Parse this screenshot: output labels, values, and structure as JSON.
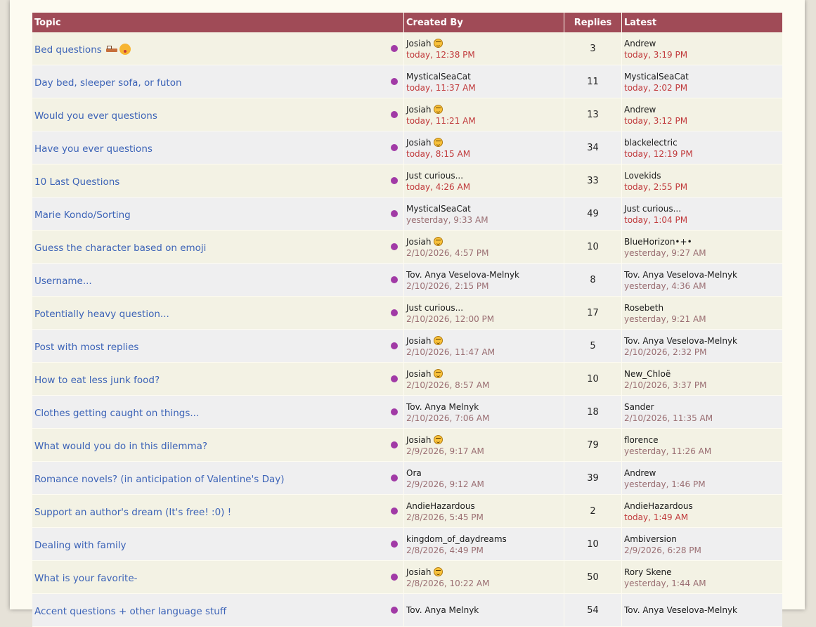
{
  "colors": {
    "header_bg": "#a04b57",
    "link": "#3c63b7",
    "dot": "#a13aa6",
    "recent_time": "#c0393b",
    "old_time": "#9a6e72"
  },
  "headers": {
    "topic": "Topic",
    "created_by": "Created By",
    "replies": "Replies",
    "latest": "Latest"
  },
  "topics": [
    {
      "title": "Bed questions",
      "title_icons": [
        "bed-icon",
        "kiss-face-icon"
      ],
      "creator": "Josiah",
      "creator_icon": "upside-down-face-icon",
      "created": "today, 12:38 PM",
      "created_recent": true,
      "replies": "3",
      "latest_user": "Andrew",
      "latest_time": "today, 3:19 PM",
      "latest_recent": true
    },
    {
      "title": "Day bed, sleeper sofa, or futon",
      "creator": "MysticalSeaCat",
      "created": "today, 11:37 AM",
      "created_recent": true,
      "replies": "11",
      "latest_user": "MysticalSeaCat",
      "latest_time": "today, 2:02 PM",
      "latest_recent": true
    },
    {
      "title": "Would you ever questions",
      "creator": "Josiah",
      "creator_icon": "upside-down-face-icon",
      "created": "today, 11:21 AM",
      "created_recent": true,
      "replies": "13",
      "latest_user": "Andrew",
      "latest_time": "today, 3:12 PM",
      "latest_recent": true
    },
    {
      "title": "Have you ever questions",
      "creator": "Josiah",
      "creator_icon": "upside-down-face-icon",
      "created": "today, 8:15 AM",
      "created_recent": true,
      "replies": "34",
      "latest_user": "blackelectric",
      "latest_time": "today, 12:19 PM",
      "latest_recent": true
    },
    {
      "title": "10 Last Questions",
      "creator": "Just curious...",
      "created": "today, 4:26 AM",
      "created_recent": true,
      "replies": "33",
      "latest_user": "Lovekids",
      "latest_time": "today, 2:55 PM",
      "latest_recent": true
    },
    {
      "title": "Marie Kondo/Sorting",
      "creator": "MysticalSeaCat",
      "created": "yesterday, 9:33 AM",
      "created_recent": false,
      "replies": "49",
      "latest_user": "Just curious...",
      "latest_time": "today, 1:04 PM",
      "latest_recent": true
    },
    {
      "title": "Guess the character based on emoji",
      "creator": "Josiah",
      "creator_icon": "upside-down-face-icon",
      "created": "2/10/2026, 4:57 PM",
      "created_recent": false,
      "replies": "10",
      "latest_user": "BlueHorizon•+•",
      "latest_time": "yesterday, 9:27 AM",
      "latest_recent": false
    },
    {
      "title": "Username...",
      "creator": "Tov. Anya Veselova-Melnyk",
      "created": "2/10/2026, 2:15 PM",
      "created_recent": false,
      "replies": "8",
      "latest_user": "Tov. Anya Veselova-Melnyk",
      "latest_time": "yesterday, 4:36 AM",
      "latest_recent": false
    },
    {
      "title": "Potentially heavy question...",
      "creator": "Just curious...",
      "created": "2/10/2026, 12:00 PM",
      "created_recent": false,
      "replies": "17",
      "latest_user": "Rosebeth",
      "latest_time": "yesterday, 9:21 AM",
      "latest_recent": false
    },
    {
      "title": "Post with most replies",
      "creator": "Josiah",
      "creator_icon": "upside-down-face-icon",
      "created": "2/10/2026, 11:47 AM",
      "created_recent": false,
      "replies": "5",
      "latest_user": "Tov. Anya Veselova-Melnyk",
      "latest_time": "2/10/2026, 2:32 PM",
      "latest_recent": false
    },
    {
      "title": "How to eat less junk food?",
      "creator": "Josiah",
      "creator_icon": "upside-down-face-icon",
      "created": "2/10/2026, 8:57 AM",
      "created_recent": false,
      "replies": "10",
      "latest_user": "New_Chloë",
      "latest_time": "2/10/2026, 3:37 PM",
      "latest_recent": false
    },
    {
      "title": "Clothes getting caught on things...",
      "creator": "Tov. Anya Melnyk",
      "created": "2/10/2026, 7:06 AM",
      "created_recent": false,
      "replies": "18",
      "latest_user": "Sander",
      "latest_time": "2/10/2026, 11:35 AM",
      "latest_recent": false
    },
    {
      "title": "What would you do in this dilemma?",
      "creator": "Josiah",
      "creator_icon": "upside-down-face-icon",
      "created": "2/9/2026, 9:17 AM",
      "created_recent": false,
      "replies": "79",
      "latest_user": "florence",
      "latest_time": "yesterday, 11:26 AM",
      "latest_recent": false
    },
    {
      "title": "Romance novels? (in anticipation of Valentine's Day)",
      "creator": "Ora",
      "created": "2/9/2026, 9:12 AM",
      "created_recent": false,
      "replies": "39",
      "latest_user": "Andrew",
      "latest_time": "yesterday, 1:46 PM",
      "latest_recent": false
    },
    {
      "title": "Support an author's dream (It's free! :0) !",
      "creator": "AndieHazardous",
      "created": "2/8/2026, 5:45 PM",
      "created_recent": false,
      "replies": "2",
      "latest_user": "AndieHazardous",
      "latest_time": "today, 1:49 AM",
      "latest_recent": true
    },
    {
      "title": "Dealing with family",
      "creator": "kingdom_of_daydreams",
      "created": "2/8/2026, 4:49 PM",
      "created_recent": false,
      "replies": "10",
      "latest_user": "Ambiversion",
      "latest_time": "2/9/2026, 6:28 PM",
      "latest_recent": false
    },
    {
      "title": "What is your favorite-",
      "creator": "Josiah",
      "creator_icon": "upside-down-face-icon",
      "created": "2/8/2026, 10:22 AM",
      "created_recent": false,
      "replies": "50",
      "latest_user": "Rory Skene",
      "latest_time": "yesterday, 1:44 AM",
      "latest_recent": false
    },
    {
      "title": "Accent questions + other language stuff",
      "creator": "Tov. Anya Melnyk",
      "created": "",
      "created_recent": false,
      "replies": "54",
      "latest_user": "Tov. Anya Veselova-Melnyk",
      "latest_time": "",
      "latest_recent": false
    }
  ]
}
